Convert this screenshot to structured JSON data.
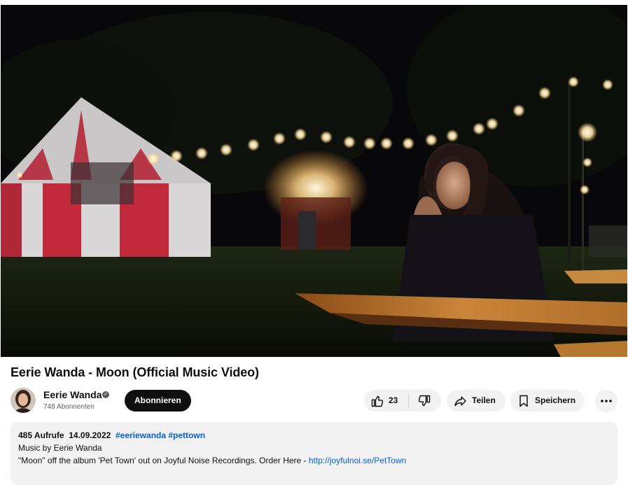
{
  "video": {
    "title": "Eerie Wanda - Moon (Official Music Video)"
  },
  "channel": {
    "name": "Eerie Wanda",
    "subscribers": "748 Abonnenten",
    "subscribe_label": "Abonnieren"
  },
  "actions": {
    "like_count": "23",
    "share_label": "Teilen",
    "save_label": "Speichern"
  },
  "description": {
    "views": "485 Aufrufe",
    "date": "14.09.2022",
    "hashtags": [
      "#eeriewanda",
      "#pettown"
    ],
    "line1": "Music by Eerie Wanda",
    "line2_text": "\"Moon\" off the album 'Pet Town' out on Joyful Noise Recordings. Order Here - ",
    "line2_link": "http://joyfulnoi.se/PetTown"
  },
  "icons": {
    "like": "thumbs-up-icon",
    "dislike": "thumbs-down-icon",
    "share": "share-arrow-icon",
    "save": "bookmark-icon",
    "more": "more-horizontal-icon",
    "verified": "verified-check-icon"
  }
}
